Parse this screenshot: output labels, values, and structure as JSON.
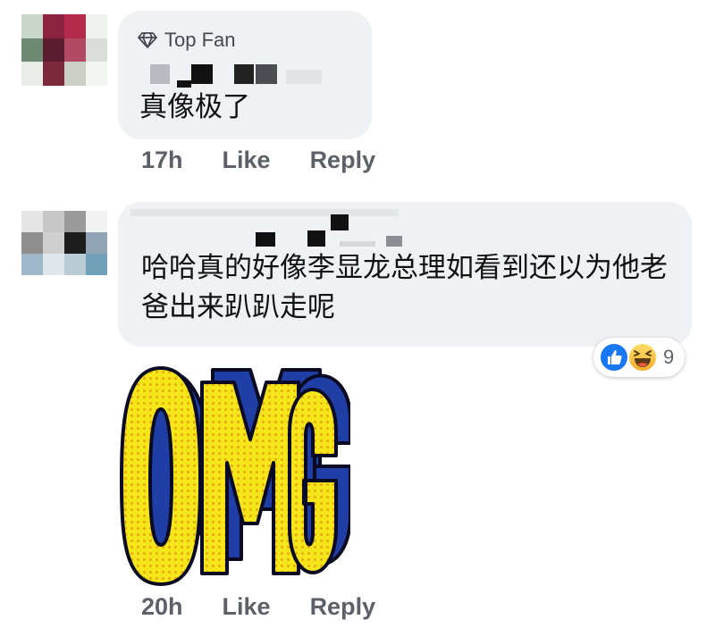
{
  "comments": [
    {
      "badge": "Top Fan",
      "text": "真像极了",
      "time": "17h",
      "like_label": "Like",
      "reply_label": "Reply"
    },
    {
      "text": "哈哈真的好像李显龙总理如看到还以为他老爸出来趴趴走呢",
      "reaction_count": "9",
      "reaction_icons": [
        "like-icon",
        "haha-icon"
      ],
      "sticker_text": "OMG",
      "time": "20h",
      "like_label": "Like",
      "reply_label": "Reply"
    }
  ],
  "colors": {
    "bubble": "#eff1f4",
    "meta_text": "#5c6068",
    "like_blue": "#1877f2",
    "sticker_yellow": "#f5e61a",
    "sticker_blue": "#1f3fa6"
  }
}
